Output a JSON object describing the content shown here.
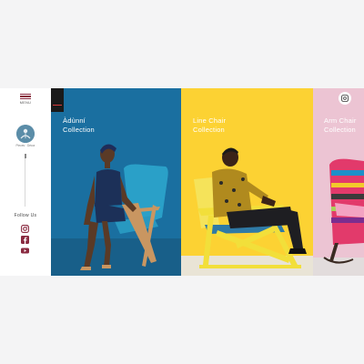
{
  "sidebar": {
    "menu_label": "MENU",
    "logo_text": "Pieces · Décor",
    "follow_label": "Follow Us",
    "social": [
      {
        "icon": "instagram-icon"
      },
      {
        "icon": "facebook-icon"
      },
      {
        "icon": "youtube-icon"
      }
    ]
  },
  "panels": [
    {
      "title_line1": "Àdùnní",
      "title_line2": "Collection",
      "color": "#1a6fa0"
    },
    {
      "title_line1": "Line Chair",
      "title_line2": "Collection",
      "color": "#fcd233"
    },
    {
      "title_line1": "Arm Chair",
      "title_line2": "Collection",
      "color": "#ecc4d3"
    }
  ],
  "colors": {
    "accent": "#8a2a40",
    "page_background": "#f4f4f5"
  }
}
